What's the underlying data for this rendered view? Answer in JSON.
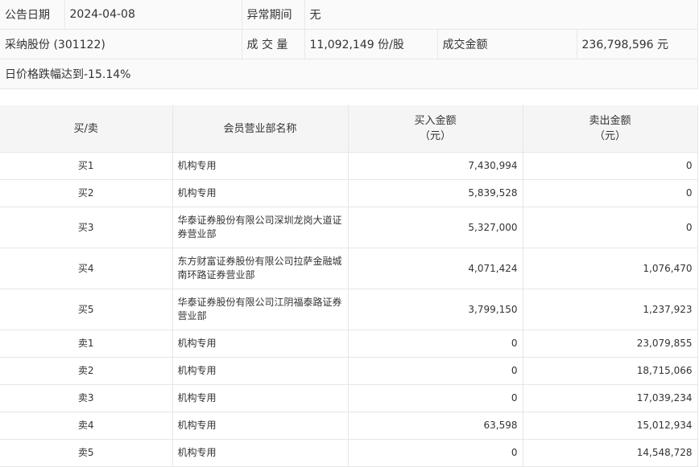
{
  "header": {
    "announce_date_label": "公告日期",
    "announce_date": "2024-04-08",
    "abnormal_period_label": "异常期间",
    "abnormal_period": "无",
    "stock": "采纳股份 (301122)",
    "volume_label": "成 交 量",
    "volume": "11,092,149 份/股",
    "amount_label": "成交金额",
    "amount": "236,798,596 元",
    "reason": "日价格跌幅达到-15.14%"
  },
  "table": {
    "headers": {
      "side": "买/卖",
      "branch": "会员营业部名称",
      "buy_line1": "买入金额",
      "buy_line2": "（元）",
      "sell_line1": "卖出金额",
      "sell_line2": "（元）"
    },
    "rows": [
      {
        "side": "买1",
        "branch": "机构专用",
        "buy": "7,430,994",
        "sell": "0"
      },
      {
        "side": "买2",
        "branch": "机构专用",
        "buy": "5,839,528",
        "sell": "0"
      },
      {
        "side": "买3",
        "branch": "华泰证券股份有限公司深圳龙岗大道证券营业部",
        "buy": "5,327,000",
        "sell": "0"
      },
      {
        "side": "买4",
        "branch": "东方财富证券股份有限公司拉萨金融城南环路证券营业部",
        "buy": "4,071,424",
        "sell": "1,076,470"
      },
      {
        "side": "买5",
        "branch": "华泰证券股份有限公司江阴福泰路证券营业部",
        "buy": "3,799,150",
        "sell": "1,237,923"
      },
      {
        "side": "卖1",
        "branch": "机构专用",
        "buy": "0",
        "sell": "23,079,855"
      },
      {
        "side": "卖2",
        "branch": "机构专用",
        "buy": "0",
        "sell": "18,715,066"
      },
      {
        "side": "卖3",
        "branch": "机构专用",
        "buy": "0",
        "sell": "17,039,234"
      },
      {
        "side": "卖4",
        "branch": "机构专用",
        "buy": "63,598",
        "sell": "15,012,934"
      },
      {
        "side": "卖5",
        "branch": "机构专用",
        "buy": "0",
        "sell": "14,548,728"
      }
    ]
  }
}
